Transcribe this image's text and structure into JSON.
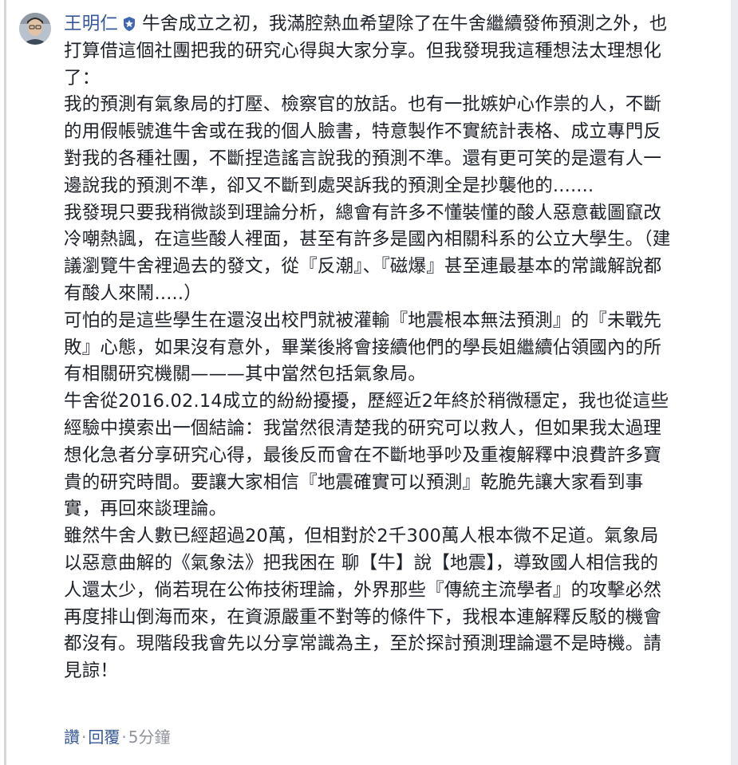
{
  "comment": {
    "author": "王明仁",
    "badge_icon": "verified-shield-icon",
    "avatar": "avatar-photo",
    "text": "牛舍成立之初，我滿腔熱血希望除了在牛舍繼續發佈預測之外，也打算借這個社團把我的研究心得與大家分享。但我發現我這種想法太理想化了：\n我的預測有氣象局的打壓、檢察官的放話。也有一批嫉妒心作祟的人，不斷的用假帳號進牛舍或在我的個人臉書，特意製作不實統計表格、成立專門反對我的各種社團，不斷捏造謠言說我的預測不準。還有更可笑的是還有人一邊說我的預測不準，卻又不斷到處哭訴我的預測全是抄襲他的.......\n我發現只要我稍微談到理論分析，總會有許多不懂裝懂的酸人惡意截圖竄改冷嘲熱諷，在這些酸人裡面，甚至有許多是國內相關科系的公立大學生。（建議瀏覽牛舍裡過去的發文，從『反潮』、『磁爆』甚至連最基本的常識解說都有酸人來鬧.....）\n可怕的是這些學生在還沒出校門就被灌輸『地震根本無法預測』的『未戰先敗』心態，如果沒有意外，畢業後將會接續他們的學長姐繼續佔領國內的所有相關研究機關———其中當然包括氣象局。\n牛舍從2016.02.14成立的紛紛擾擾，歷經近2年終於稍微穩定，我也從這些經驗中摸索出一個結論：我當然很清楚我的研究可以救人，但如果我太過理想化急者分享研究心得，最後反而會在不斷地爭吵及重複解釋中浪費許多寶貴的研究時間。要讓大家相信『地震確實可以預測』乾脆先讓大家看到事實，再回來談理論。\n雖然牛舍人數已經超過20萬，但相對於2千300萬人根本微不足道。氣象局以惡意曲解的《氣象法》把我困在 聊【牛】說【地震】，導致國人相信我的人還太少，倘若現在公佈技術理論，外界那些『傳統主流學者』的攻擊必然再度排山倒海而來，在資源嚴重不對等的條件下，我根本連解釋反駁的機會都沒有。現階段我會先以分享常識為主，至於探討預測理論還不是時機。請見諒！"
  },
  "actions": {
    "like_label": "讚",
    "reply_label": "回覆",
    "separator": "·",
    "timestamp": "5分鐘"
  },
  "colors": {
    "link": "#365899",
    "meta": "#90949c",
    "text": "#1d2129"
  }
}
